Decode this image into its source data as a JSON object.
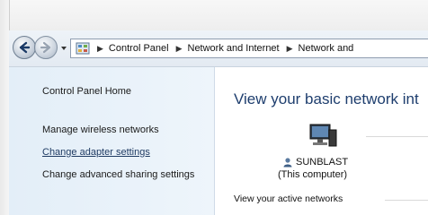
{
  "address_bar": {
    "crumbs": [
      "Control Panel",
      "Network and Internet",
      "Network and"
    ]
  },
  "left_pane": {
    "home_link": "Control Panel Home",
    "links": [
      "Manage wireless networks",
      "Change adapter settings",
      "Change advanced sharing settings"
    ]
  },
  "main": {
    "title": "View your basic network int",
    "computer_name": "SUNBLAST",
    "computer_sub": "(This computer)",
    "active_networks_label": "View your active networks"
  },
  "icons": {
    "back": "back-arrow-icon",
    "forward": "forward-arrow-icon",
    "control_panel": "control-panel-icon",
    "computer": "computer-icon",
    "user": "user-icon"
  },
  "colors": {
    "title": "#1e3e6e",
    "left_pane_bg": "#e3eef8",
    "link": "#1a1a1a"
  }
}
